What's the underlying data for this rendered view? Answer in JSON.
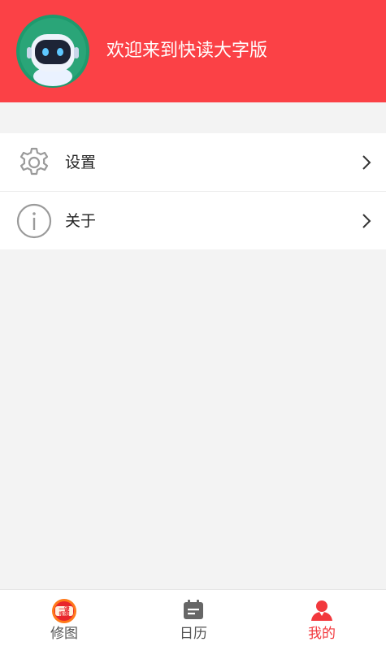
{
  "header": {
    "welcome_text": "欢迎来到快读大字版",
    "background_color": "#fb4146",
    "avatar_icon": "robot-avatar-icon"
  },
  "menu": {
    "items": [
      {
        "label": "设置",
        "icon": "gear-icon"
      },
      {
        "label": "关于",
        "icon": "info-icon"
      }
    ]
  },
  "tabbar": {
    "tabs": [
      {
        "label": "修图",
        "icon": "one-click-cutout-icon",
        "icon_text_top": "一键",
        "icon_text_bottom": "抠图",
        "active": false
      },
      {
        "label": "日历",
        "icon": "calendar-icon",
        "active": false
      },
      {
        "label": "我的",
        "icon": "person-icon",
        "active": true
      }
    ],
    "active_color": "#f2383d"
  }
}
